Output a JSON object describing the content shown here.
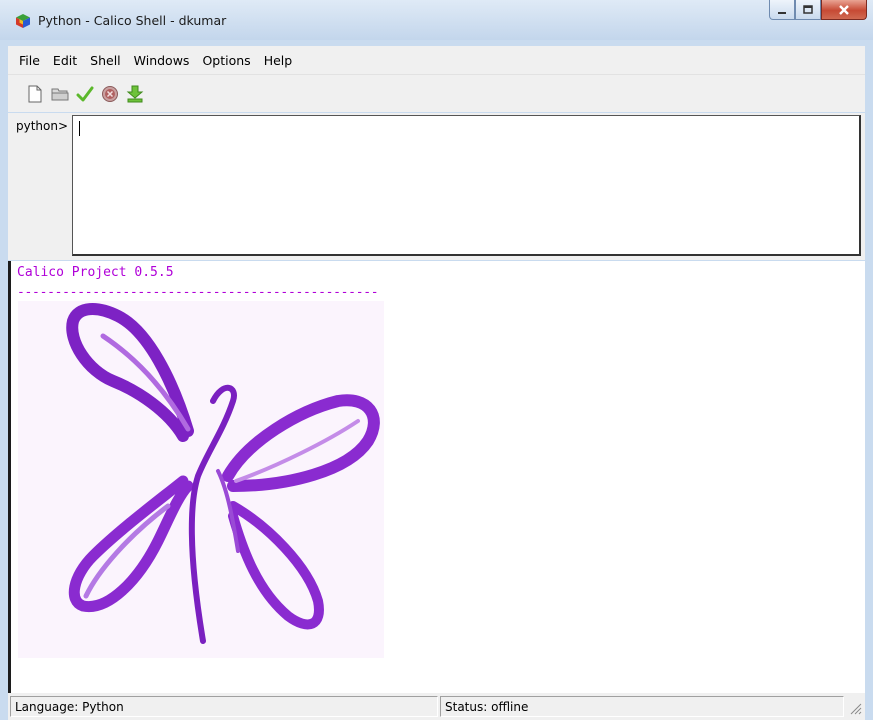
{
  "window": {
    "title": "Python - Calico Shell - dkumar",
    "app_icon": "calico-cube-icon",
    "controls": [
      "minimize-icon",
      "maximize-icon",
      "close-icon"
    ]
  },
  "menubar": {
    "items": [
      "File",
      "Edit",
      "Shell",
      "Windows",
      "Options",
      "Help"
    ]
  },
  "toolbar": {
    "icons": [
      "new-file-icon",
      "open-folder-icon",
      "run-check-icon",
      "stop-icon",
      "download-icon"
    ]
  },
  "shell": {
    "prompt": "python>",
    "input_value": ""
  },
  "output": {
    "title": "Calico Project 0.5.5",
    "rule": "------------------------------------------------",
    "image": "purple-butterfly-drawing"
  },
  "statusbar": {
    "language": "Language: Python",
    "status": "Status: offline"
  },
  "colors": {
    "accent_text": "#b000d8",
    "butterfly_purple": "#8a2bd0"
  }
}
